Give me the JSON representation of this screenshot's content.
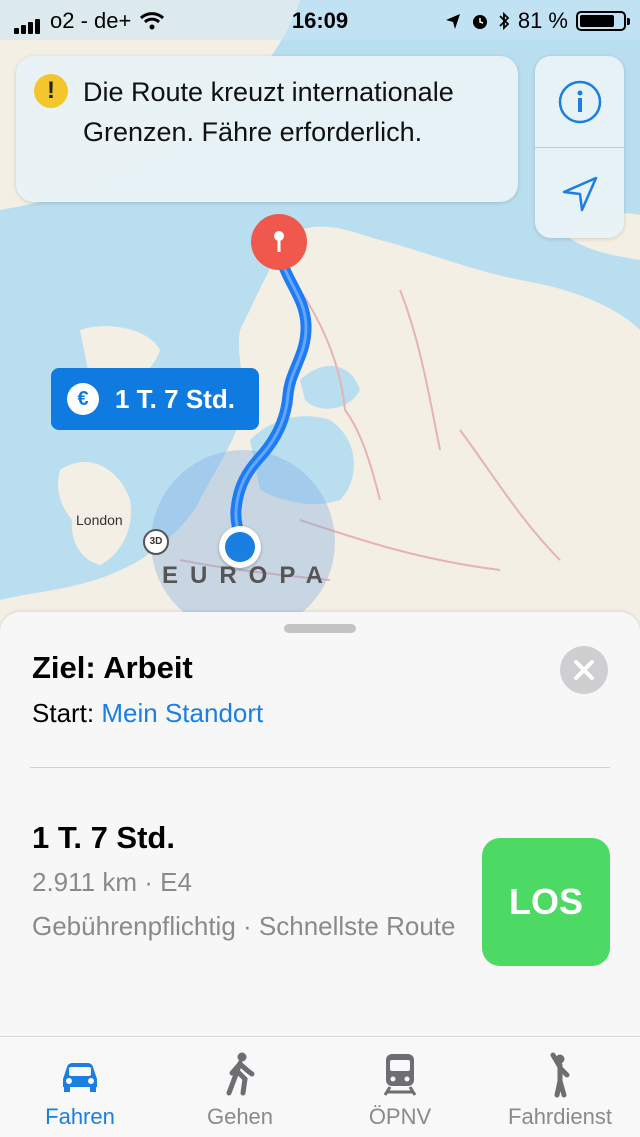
{
  "status_bar": {
    "carrier": "o2 - de+",
    "time": "16:09",
    "battery": "81 %",
    "battery_level": 0.81,
    "icons": [
      "signal-bars-icon",
      "wifi-icon",
      "location-arrow-icon",
      "alarm-icon",
      "bluetooth-icon",
      "battery-icon"
    ]
  },
  "map": {
    "banner_message": "Die Route kreuzt internationale Grenzen. Fähre erforderlich.",
    "route_label": "1 T. 7 Std.",
    "route_label_icon": "euro-icon",
    "place_label": "London",
    "region_label": "EUROPA",
    "badge_3d": "3D",
    "controls": [
      "info-icon",
      "location-arrow-icon"
    ]
  },
  "sheet": {
    "destination": "Ziel: Arbeit",
    "start_prefix": "Start:",
    "start_value": "Mein Standort",
    "route": {
      "duration": "1 T. 7 Std.",
      "distance": "2.911 km · E4",
      "details": "Gebührenpflichtig · Schnellste Route"
    },
    "go_label": "LOS"
  },
  "tabs": [
    {
      "label": "Fahren",
      "icon": "car-icon",
      "active": true
    },
    {
      "label": "Gehen",
      "icon": "walking-icon",
      "active": false
    },
    {
      "label": "ÖPNV",
      "icon": "train-icon",
      "active": false
    },
    {
      "label": "Fahrdienst",
      "icon": "hail-icon",
      "active": false
    }
  ],
  "colors": {
    "accent": "#1a7fe0",
    "route": "#1e7cf2",
    "go": "#4cd964",
    "warning": "#f3c62b",
    "pin": "#f0584e"
  }
}
